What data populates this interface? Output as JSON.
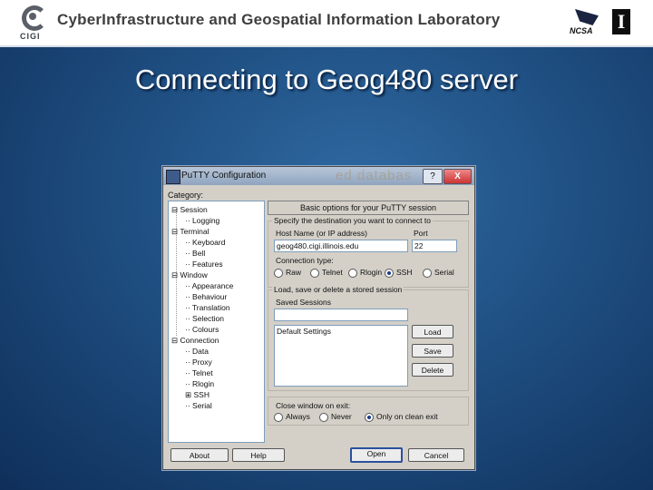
{
  "header": {
    "logo_text": "CIGI",
    "lab_title": "CyberInfrastructure and Geospatial Information Laboratory",
    "ncsa_text": "NCSA",
    "illinois_glyph": "I"
  },
  "slide": {
    "title": "Connecting to Geog480 server"
  },
  "putty": {
    "title": "PuTTY Configuration",
    "ghost_text": "ed databas",
    "help_btn": "?",
    "close_btn": "X",
    "category_label": "Category:",
    "tree": [
      "Session",
      "Logging",
      "Terminal",
      "Keyboard",
      "Bell",
      "Features",
      "Window",
      "Appearance",
      "Behaviour",
      "Translation",
      "Selection",
      "Colours",
      "Connection",
      "Data",
      "Proxy",
      "Telnet",
      "Rlogin",
      "SSH",
      "Serial"
    ],
    "panel_heading": "Basic options for your PuTTY session",
    "dest_group": "Specify the destination you want to connect to",
    "host_label": "Host Name (or IP address)",
    "host_value": "geog480.cigi.illinois.edu",
    "port_label": "Port",
    "port_value": "22",
    "conn_type_label": "Connection type:",
    "conn_types": [
      "Raw",
      "Telnet",
      "Rlogin",
      "SSH",
      "Serial"
    ],
    "conn_selected": "SSH",
    "sessions_group": "Load, save or delete a stored session",
    "saved_label": "Saved Sessions",
    "saved_value": "",
    "sessions_list": [
      "Default Settings"
    ],
    "load_btn": "Load",
    "save_btn": "Save",
    "delete_btn": "Delete",
    "close_label": "Close window on exit:",
    "close_opts": [
      "Always",
      "Never",
      "Only on clean exit"
    ],
    "close_selected": "Only on clean exit",
    "about_btn": "About",
    "help_btn2": "Help",
    "open_btn": "Open",
    "cancel_btn": "Cancel"
  }
}
